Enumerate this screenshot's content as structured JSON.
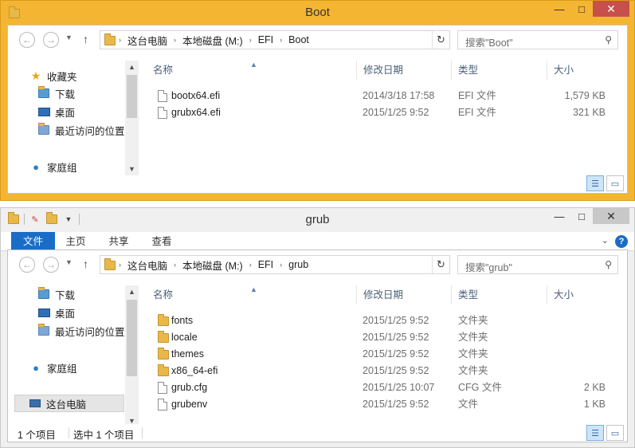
{
  "window1": {
    "title": "Boot",
    "controls": {
      "minimize": "—",
      "maximize": "□",
      "close": "✕"
    },
    "address": {
      "back": "←",
      "forward": "→",
      "segments": [
        "这台电脑",
        "本地磁盘 (M:)",
        "EFI",
        "Boot"
      ],
      "separator": "›"
    },
    "search": {
      "placeholder": "搜索\"Boot\""
    },
    "nav": {
      "items": [
        {
          "label": "收藏夹",
          "icon": "star-icon"
        },
        {
          "label": "下载",
          "icon": "download-folder-icon"
        },
        {
          "label": "桌面",
          "icon": "desktop-icon"
        },
        {
          "label": "最近访问的位置",
          "icon": "recent-places-icon"
        },
        {
          "label": "家庭组",
          "icon": "homegroup-icon"
        }
      ]
    },
    "columns": {
      "name": "名称",
      "date": "修改日期",
      "type": "类型",
      "size": "大小"
    },
    "files": [
      {
        "name": "bootx64.efi",
        "date": "2014/3/18 17:58",
        "type": "EFI 文件",
        "size": "1,579 KB",
        "icon": "efi-file-icon"
      },
      {
        "name": "grubx64.efi",
        "date": "2015/1/25 9:52",
        "type": "EFI 文件",
        "size": "321 KB",
        "icon": "efi-file-icon"
      }
    ]
  },
  "window2": {
    "title": "grub",
    "controls": {
      "minimize": "—",
      "maximize": "□",
      "close": "✕"
    },
    "ribbon": {
      "tabs": [
        "文件",
        "主页",
        "共享",
        "查看"
      ],
      "help": "?"
    },
    "address": {
      "back": "←",
      "forward": "→",
      "segments": [
        "这台电脑",
        "本地磁盘 (M:)",
        "EFI",
        "grub"
      ],
      "separator": "›"
    },
    "search": {
      "placeholder": "搜索\"grub\""
    },
    "nav": {
      "items": [
        {
          "label": "下载",
          "icon": "download-folder-icon"
        },
        {
          "label": "桌面",
          "icon": "desktop-icon"
        },
        {
          "label": "最近访问的位置",
          "icon": "recent-places-icon"
        },
        {
          "label": "家庭组",
          "icon": "homegroup-icon"
        },
        {
          "label": "这台电脑",
          "icon": "this-pc-icon",
          "selected": true
        }
      ]
    },
    "columns": {
      "name": "名称",
      "date": "修改日期",
      "type": "类型",
      "size": "大小"
    },
    "files": [
      {
        "name": "fonts",
        "date": "2015/1/25 9:52",
        "type": "文件夹",
        "size": "",
        "icon": "folder-icon"
      },
      {
        "name": "locale",
        "date": "2015/1/25 9:52",
        "type": "文件夹",
        "size": "",
        "icon": "folder-icon"
      },
      {
        "name": "themes",
        "date": "2015/1/25 9:52",
        "type": "文件夹",
        "size": "",
        "icon": "folder-icon"
      },
      {
        "name": "x86_64-efi",
        "date": "2015/1/25 9:52",
        "type": "文件夹",
        "size": "",
        "icon": "folder-icon"
      },
      {
        "name": "grub.cfg",
        "date": "2015/1/25 10:07",
        "type": "CFG 文件",
        "size": "2 KB",
        "icon": "file-icon"
      },
      {
        "name": "grubenv",
        "date": "2015/1/25 9:52",
        "type": "文件",
        "size": "1 KB",
        "icon": "file-icon"
      }
    ],
    "status": {
      "item_count": "1 个项目",
      "selected": "选中 1 个项目"
    }
  },
  "colors": {
    "active_title": "#f4b533",
    "close_button": "#c7504a",
    "ribbon_file_tab": "#1a6dc7",
    "column_header_text": "#4c607a"
  }
}
